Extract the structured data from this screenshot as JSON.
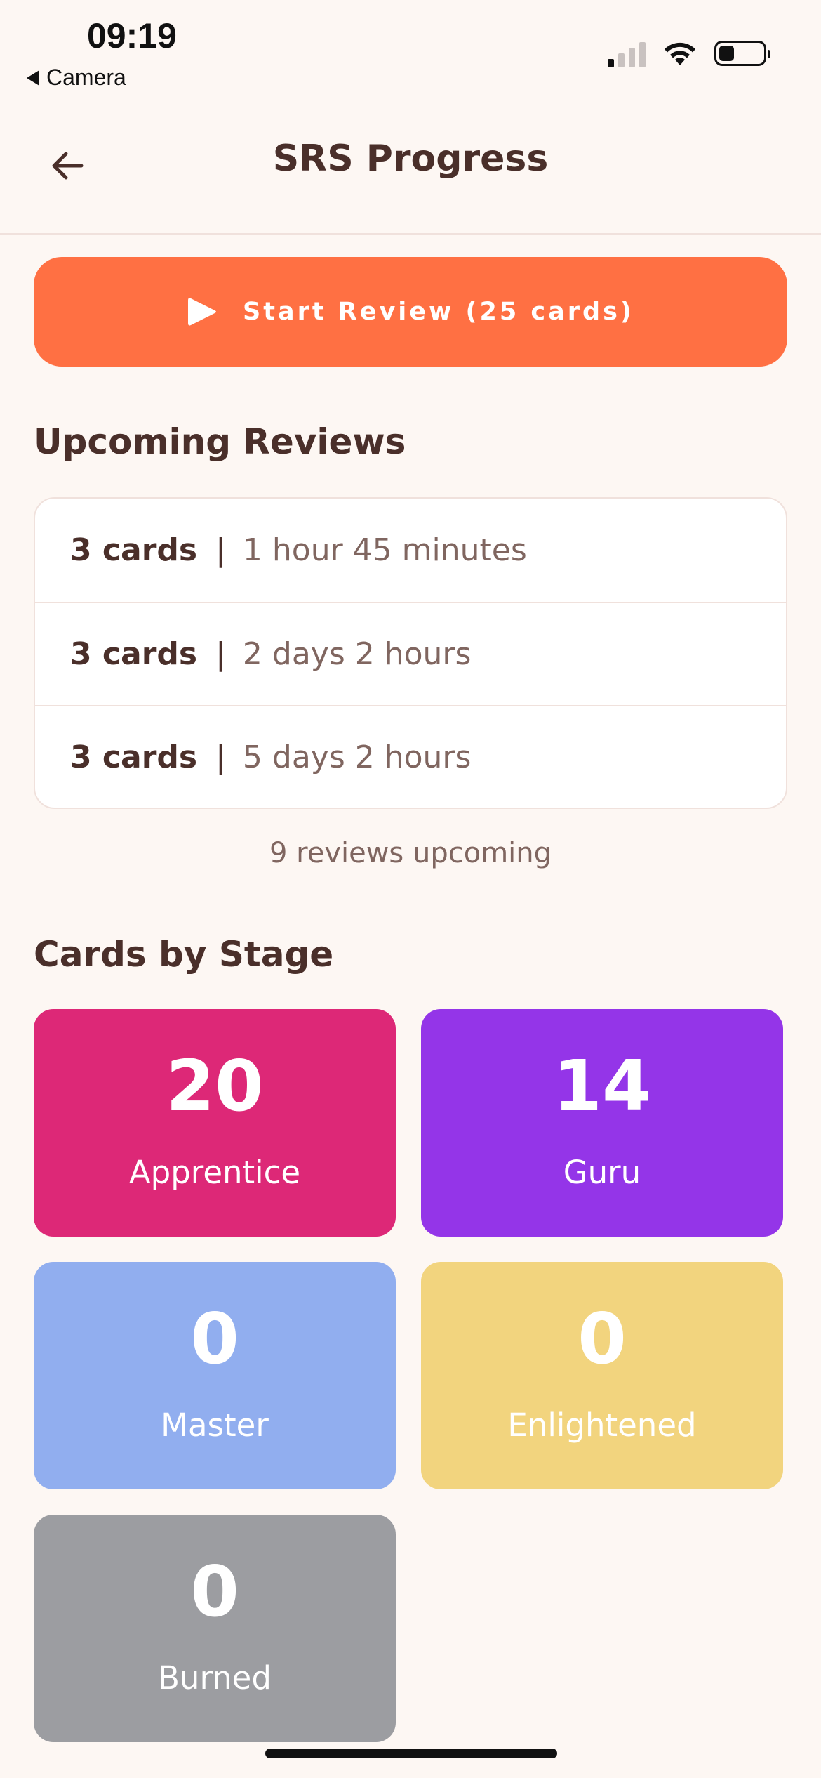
{
  "status_bar": {
    "time": "09:19",
    "back_app": "Camera",
    "signal_icon": "cellular-signal-icon",
    "wifi_icon": "wifi-icon",
    "battery_icon": "battery-icon",
    "battery_level": 0.35
  },
  "header": {
    "back_icon": "arrow-left-icon",
    "title": "SRS Progress"
  },
  "start_review": {
    "icon": "play-icon",
    "label": "Start Review (25 cards)",
    "color": "#FF7043"
  },
  "upcoming": {
    "title": "Upcoming Reviews",
    "separator": "|",
    "rows": [
      {
        "count": "3 cards",
        "time": "1 hour 45 minutes"
      },
      {
        "count": "3 cards",
        "time": "2 days 2 hours"
      },
      {
        "count": "3 cards",
        "time": "5 days 2 hours"
      }
    ],
    "summary": "9 reviews upcoming"
  },
  "stages": {
    "title": "Cards by Stage",
    "items": [
      {
        "count": "20",
        "label": "Apprentice",
        "color": "#DD2877"
      },
      {
        "count": "14",
        "label": "Guru",
        "color": "#9435E8"
      },
      {
        "count": "0",
        "label": "Master",
        "color": "#91AEEF"
      },
      {
        "count": "0",
        "label": "Enlightened",
        "color": "#F2D47E"
      },
      {
        "count": "0",
        "label": "Burned",
        "color": "#9C9DA1"
      }
    ]
  }
}
